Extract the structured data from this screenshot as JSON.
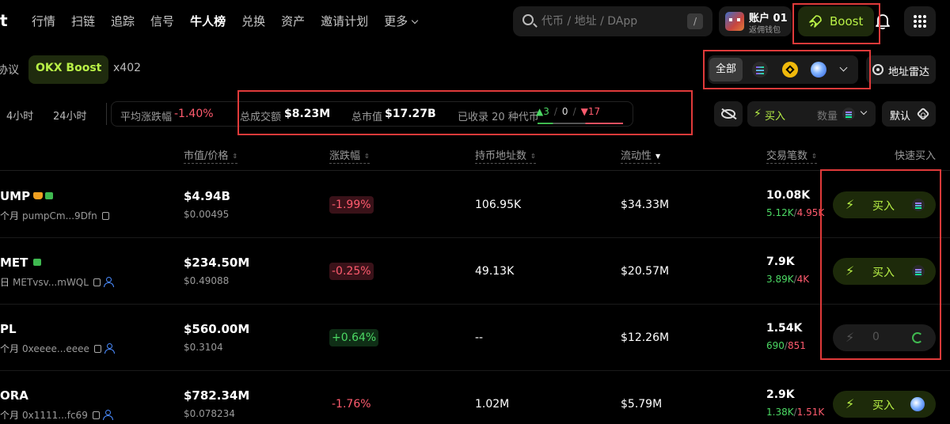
{
  "nav": {
    "logo": "t",
    "items": [
      "行情",
      "扫链",
      "追踪",
      "信号",
      "牛人榜",
      "兑换",
      "资产",
      "邀请计划",
      "更多"
    ],
    "active_index": 4
  },
  "search": {
    "placeholder": "代币 / 地址 / DApp",
    "shortcut": "/"
  },
  "account": {
    "name": "账户 01",
    "sub": "返佣钱包"
  },
  "boost": {
    "label": "Boost"
  },
  "tabs2": {
    "items": [
      "协议",
      "OKX Boost",
      "x402"
    ],
    "active_index": 1
  },
  "chain_filter": {
    "all_label": "全部",
    "chains": [
      "solana-icon",
      "bnb-icon",
      "base-icon"
    ]
  },
  "radar": {
    "label": "地址雷达"
  },
  "timeframes": [
    "4小时",
    "24小时"
  ],
  "stats": {
    "avg_change_label": "平均涨跌幅",
    "avg_change_value": "-1.40%",
    "volume_label": "总成交额",
    "volume_value": "$8.23M",
    "mcap_label": "总市值",
    "mcap_value": "$17.27B",
    "tokens_label": "已收录 20 种代币",
    "up_count": "3",
    "flat_count": "0",
    "down_count": "17"
  },
  "buy_config": {
    "label": "买入",
    "qty_placeholder": "数量"
  },
  "default_btn": {
    "label": "默认"
  },
  "table": {
    "headers": {
      "mcap": "市值/价格",
      "change": "涨跌幅",
      "holders": "持币地址数",
      "liquidity": "流动性",
      "txns": "交易笔数",
      "quick_buy": "快速买入"
    },
    "rows": [
      {
        "name": "UMP",
        "age": "个月",
        "addr": "pumpCm...9Dfn",
        "mcap": "$4.94B",
        "price": "$0.00495",
        "change": "-1.99%",
        "change_dir": "neg",
        "holders": "106.95K",
        "liquidity": "$34.33M",
        "txns": "10.08K",
        "buys": "5.12K",
        "sells": "4.95K",
        "buy_label": "买入",
        "buy_state": "sol"
      },
      {
        "name": "MET",
        "age": "日",
        "addr": "METvsv...mWQL",
        "mcap": "$234.50M",
        "price": "$0.49088",
        "change": "-0.25%",
        "change_dir": "neg",
        "holders": "49.13K",
        "liquidity": "$20.57M",
        "txns": "7.9K",
        "buys": "3.89K",
        "sells": "4K",
        "buy_label": "买入",
        "buy_state": "sol"
      },
      {
        "name": "PL",
        "age": "个月",
        "addr": "0xeeee...eeee",
        "mcap": "$560.00M",
        "price": "$0.3104",
        "change": "+0.64%",
        "change_dir": "pos",
        "holders": "--",
        "liquidity": "$12.26M",
        "txns": "1.54K",
        "buys": "690",
        "sells": "851",
        "buy_label": "0",
        "buy_state": "disabled"
      },
      {
        "name": "ORA",
        "age": "个月",
        "addr": "0x1111...fc69",
        "mcap": "$782.34M",
        "price": "$0.078234",
        "change": "-1.76%",
        "change_dir": "neg-plain",
        "holders": "1.02M",
        "liquidity": "$5.79M",
        "txns": "2.9K",
        "buys": "1.38K",
        "sells": "1.51K",
        "buy_label": "买入",
        "buy_state": "base"
      }
    ]
  },
  "colors": {
    "accent": "#b8f046",
    "up": "#4cd964",
    "down": "#ff5b6e",
    "annotation": "#e03a3a"
  }
}
